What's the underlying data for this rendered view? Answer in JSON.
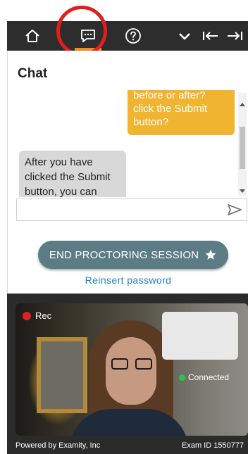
{
  "toolbar": {
    "items": [
      {
        "name": "home",
        "icon": "home-icon"
      },
      {
        "name": "chat",
        "icon": "chat-icon",
        "active": true
      },
      {
        "name": "help",
        "icon": "help-icon"
      },
      {
        "name": "collapse",
        "icon": "chevron-down-icon"
      },
      {
        "name": "dock-left",
        "icon": "arrow-left-bar-icon"
      },
      {
        "name": "dock-right",
        "icon": "arrow-right-bar-icon"
      }
    ],
    "active_underline_color": "#f08a24",
    "background": "#2d2d2d"
  },
  "highlight_color": "#e01e1e",
  "chat": {
    "title": "Chat",
    "messages": [
      {
        "from": "user",
        "line1": "before or after?",
        "line2": "click the Submit button?",
        "color": "#f0b431"
      },
      {
        "from": "proctor",
        "text": "After you have clicked the Submit button, you can",
        "color": "#d8d8d8"
      }
    ],
    "input_placeholder": "",
    "send_icon": "send-icon"
  },
  "end_button": {
    "label": "END PROCTORING SESSION",
    "icon": "star-icon",
    "color": "#5b7b85"
  },
  "reinsert_link": "Reinsert password",
  "video": {
    "rec_label": "Rec",
    "connected_label": "Connected"
  },
  "footer": {
    "powered_by": "Powered by Examity, Inc",
    "exam_id": "Exam ID 1550777"
  }
}
